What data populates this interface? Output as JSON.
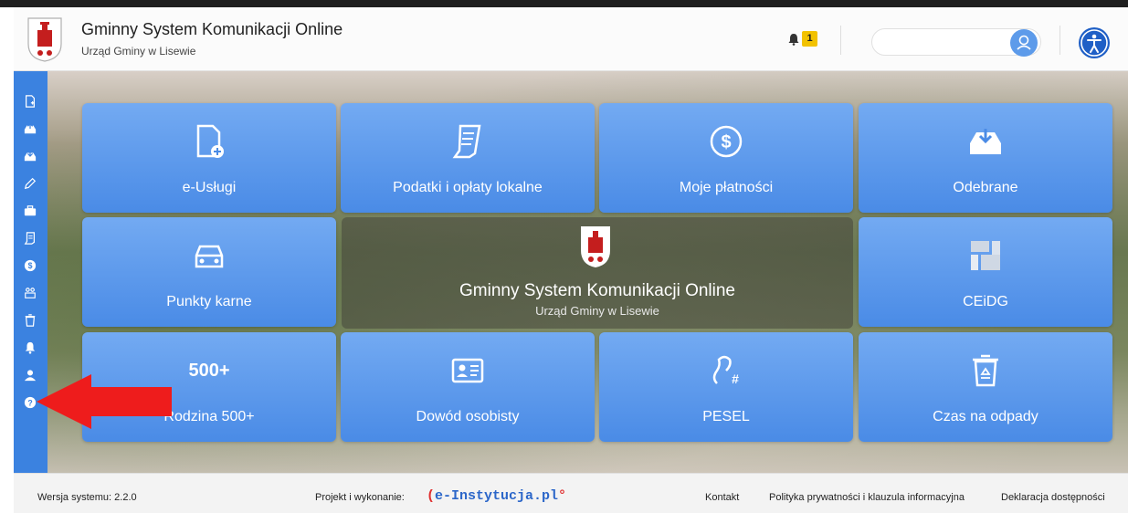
{
  "header": {
    "title": "Gminny System Komunikacji Online",
    "subtitle": "Urząd Gminy w Lisewie",
    "notification_count": "1",
    "user_field_value": ""
  },
  "sidebar": {
    "items": [
      {
        "icon": "new-document-icon"
      },
      {
        "icon": "inbox-upload-icon"
      },
      {
        "icon": "inbox-download-icon"
      },
      {
        "icon": "pencil-icon"
      },
      {
        "icon": "briefcase-icon"
      },
      {
        "icon": "tax-scroll-icon"
      },
      {
        "icon": "dollar-coin-icon"
      },
      {
        "icon": "people-icon"
      },
      {
        "icon": "trash-icon"
      },
      {
        "icon": "bell-icon"
      },
      {
        "icon": "user-icon"
      },
      {
        "icon": "help-icon"
      }
    ]
  },
  "tiles": [
    {
      "label": "e-Usługi",
      "icon": "new-document-icon"
    },
    {
      "label": "Podatki i opłaty lokalne",
      "icon": "tax-scroll-icon"
    },
    {
      "label": "Moje płatności",
      "icon": "dollar-coin-icon"
    },
    {
      "label": "Odebrane",
      "icon": "inbox-download-icon"
    },
    {
      "label": "Punkty karne",
      "icon": "car-icon"
    },
    {
      "label": "CEiDG",
      "icon": "ceidg-logo-icon"
    },
    {
      "label": "Rodzina 500+",
      "icon": "rodzina-500-icon",
      "icon_text": "500+"
    },
    {
      "label": "Dowód osobisty",
      "icon": "id-card-icon"
    },
    {
      "label": "PESEL",
      "icon": "pesel-icon"
    },
    {
      "label": "Czas na odpady",
      "icon": "recycle-bin-icon"
    }
  ],
  "center": {
    "title": "Gminny System Komunikacji Online",
    "subtitle": "Urząd Gminy w Lisewie"
  },
  "footer": {
    "version": "Wersja systemu: 2.2.0",
    "project": "Projekt i wykonanie:",
    "brand": "e-Instytucja.pl",
    "brand_open": "(",
    "brand_mark": "°",
    "contact": "Kontakt",
    "privacy": "Polityka prywatności i klauzula informacyjna",
    "declaration": "Deklaracja dostępności"
  },
  "colors": {
    "sidebar": "#3b82e0",
    "tile": "#4a8be6",
    "accessibility": "#1f5fc6",
    "badge": "#f2c200",
    "arrow": "#ee1c1c"
  }
}
